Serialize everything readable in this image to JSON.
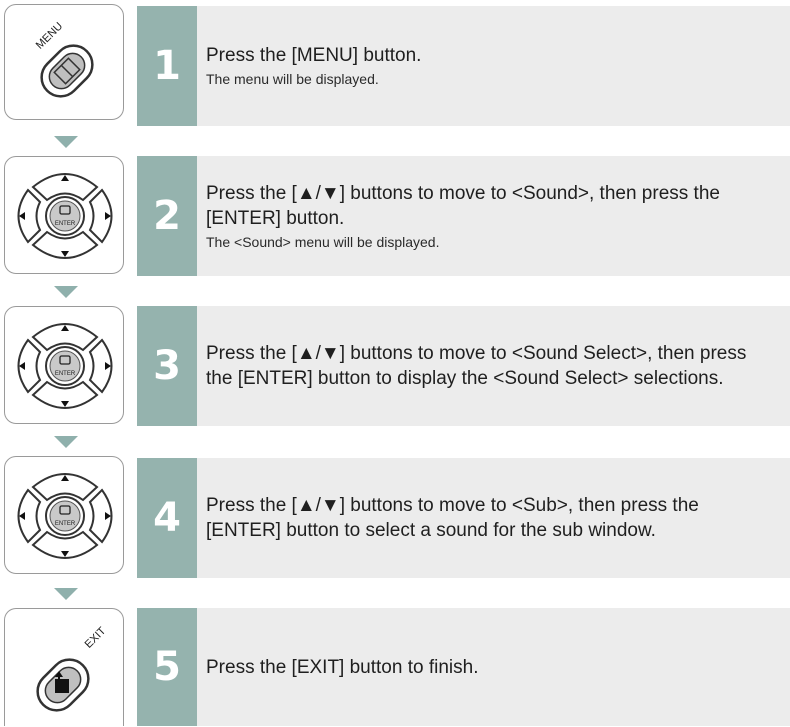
{
  "steps": [
    {
      "number": "1",
      "icon": "menu-button-icon",
      "icon_label": "MENU",
      "main": "Press the [MENU] button.",
      "sub": "The menu will be displayed."
    },
    {
      "number": "2",
      "icon": "dpad-enter-icon",
      "icon_label": "ENTER",
      "main": "Press the [▲/▼] buttons to move to <Sound>, then press the [ENTER] button.",
      "sub": "The <Sound> menu will be displayed."
    },
    {
      "number": "3",
      "icon": "dpad-enter-icon",
      "icon_label": "ENTER",
      "main": "Press the [▲/▼] buttons to move to <Sound Select>, then press the [ENTER] button to display the <Sound Select> selections.",
      "sub": ""
    },
    {
      "number": "4",
      "icon": "dpad-enter-icon",
      "icon_label": "ENTER",
      "main": "Press the [▲/▼] buttons to move to <Sub>, then press the [ENTER] button to select a sound for the sub window.",
      "sub": ""
    },
    {
      "number": "5",
      "icon": "exit-button-icon",
      "icon_label": "EXIT",
      "main": "Press the [EXIT] button to finish.",
      "sub": ""
    }
  ],
  "colors": {
    "accent_band": "#95b3ae",
    "panel_bg": "#ececec",
    "arrow": "#8fb0ac"
  }
}
